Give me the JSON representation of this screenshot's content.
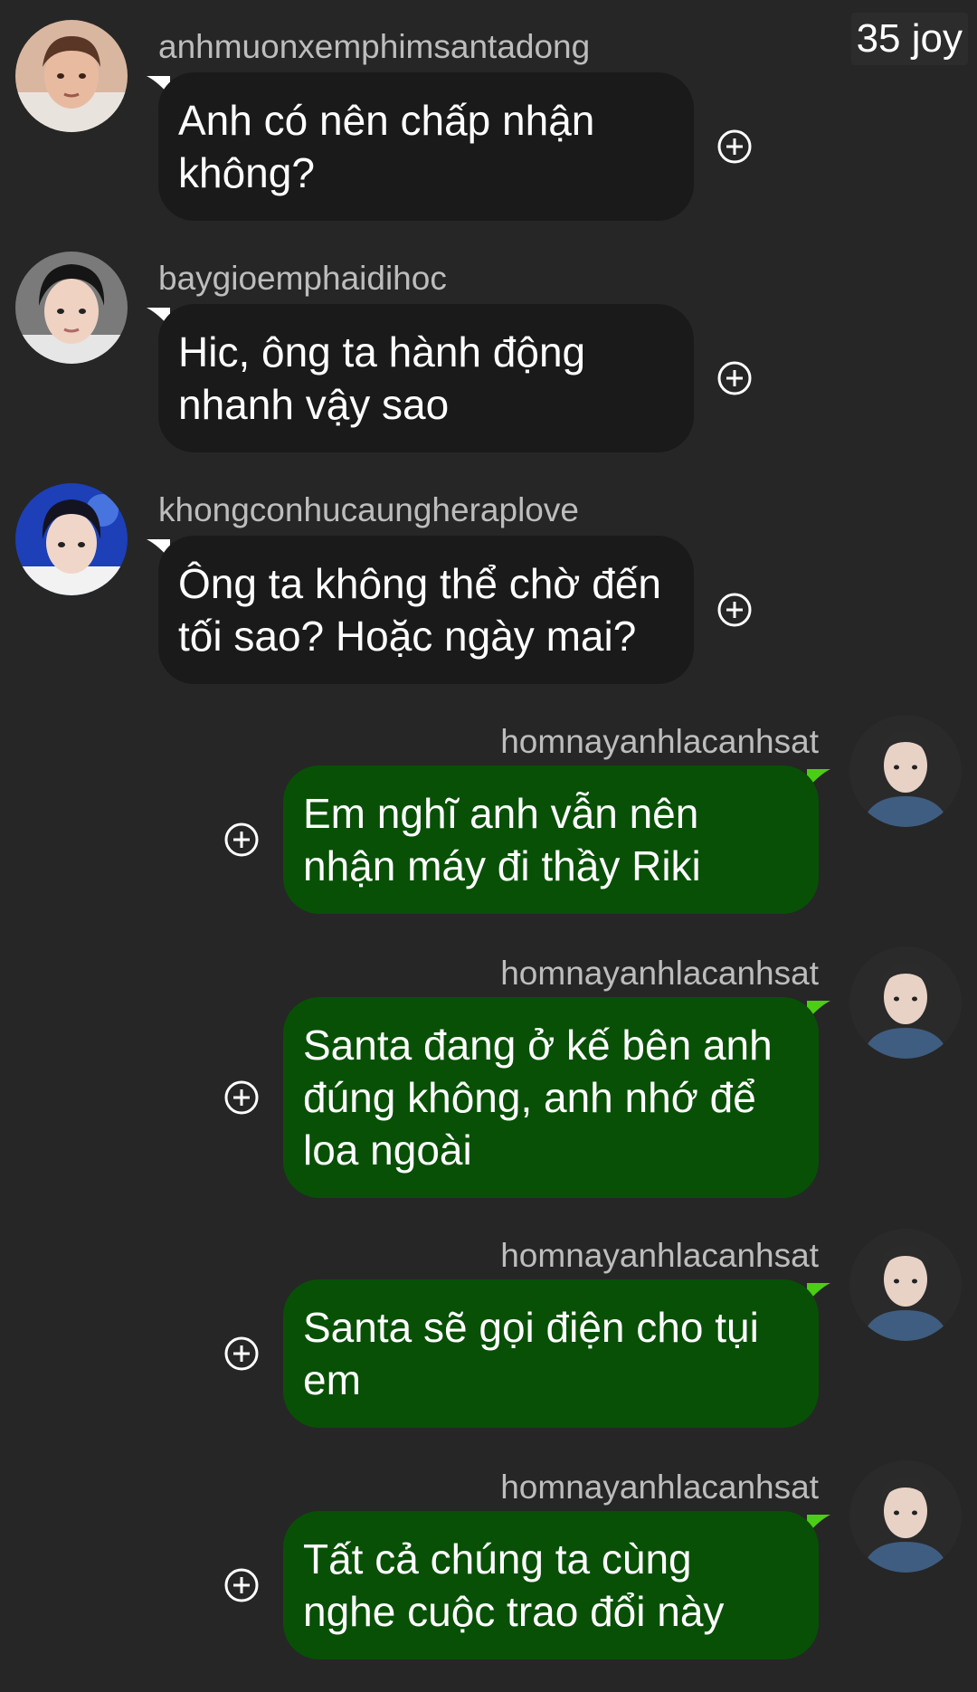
{
  "header": {
    "joy_badge": "35 joy"
  },
  "colors": {
    "background": "#262626",
    "incoming_bubble": "#1a1a1a",
    "outgoing_bubble": "#085006",
    "outgoing_tail": "#4ccd16",
    "username_text": "#bdbdbd"
  },
  "messages": [
    {
      "direction": "incoming",
      "username": "anhmuonxemphimsantadong",
      "lines": [
        "Anh có nên chấp nhận",
        "không?"
      ],
      "avatar": "avatar-man-brown-hair"
    },
    {
      "direction": "incoming",
      "username": "baygioemphaidihoc",
      "lines": [
        "Hic, ông ta hành động",
        "nhanh vậy sao"
      ],
      "avatar": "avatar-man-black-hair"
    },
    {
      "direction": "incoming",
      "username": "khongconhucaungheraplove",
      "lines": [
        "Ông ta không thể chờ đến",
        "tối sao? Hoặc ngày mai?"
      ],
      "avatar": "avatar-boy-blue-stage"
    },
    {
      "direction": "outgoing",
      "username": "homnayanhlacanhsat",
      "lines": [
        "Em nghĩ anh vẫn nên",
        "nhận máy đi thầy Riki"
      ],
      "avatar": "avatar-boy-denim-jacket"
    },
    {
      "direction": "outgoing",
      "username": "homnayanhlacanhsat",
      "lines": [
        "Santa đang ở kế bên anh",
        "đúng không, anh nhớ để",
        "loa ngoài"
      ],
      "avatar": "avatar-boy-denim-jacket"
    },
    {
      "direction": "outgoing",
      "username": "homnayanhlacanhsat",
      "lines": [
        "Santa sẽ gọi điện cho tụi",
        "em"
      ],
      "avatar": "avatar-boy-denim-jacket"
    },
    {
      "direction": "outgoing",
      "username": "homnayanhlacanhsat",
      "lines": [
        "Tất cả chúng ta cùng",
        "nghe cuộc trao đổi này"
      ],
      "avatar": "avatar-boy-denim-jacket"
    }
  ]
}
